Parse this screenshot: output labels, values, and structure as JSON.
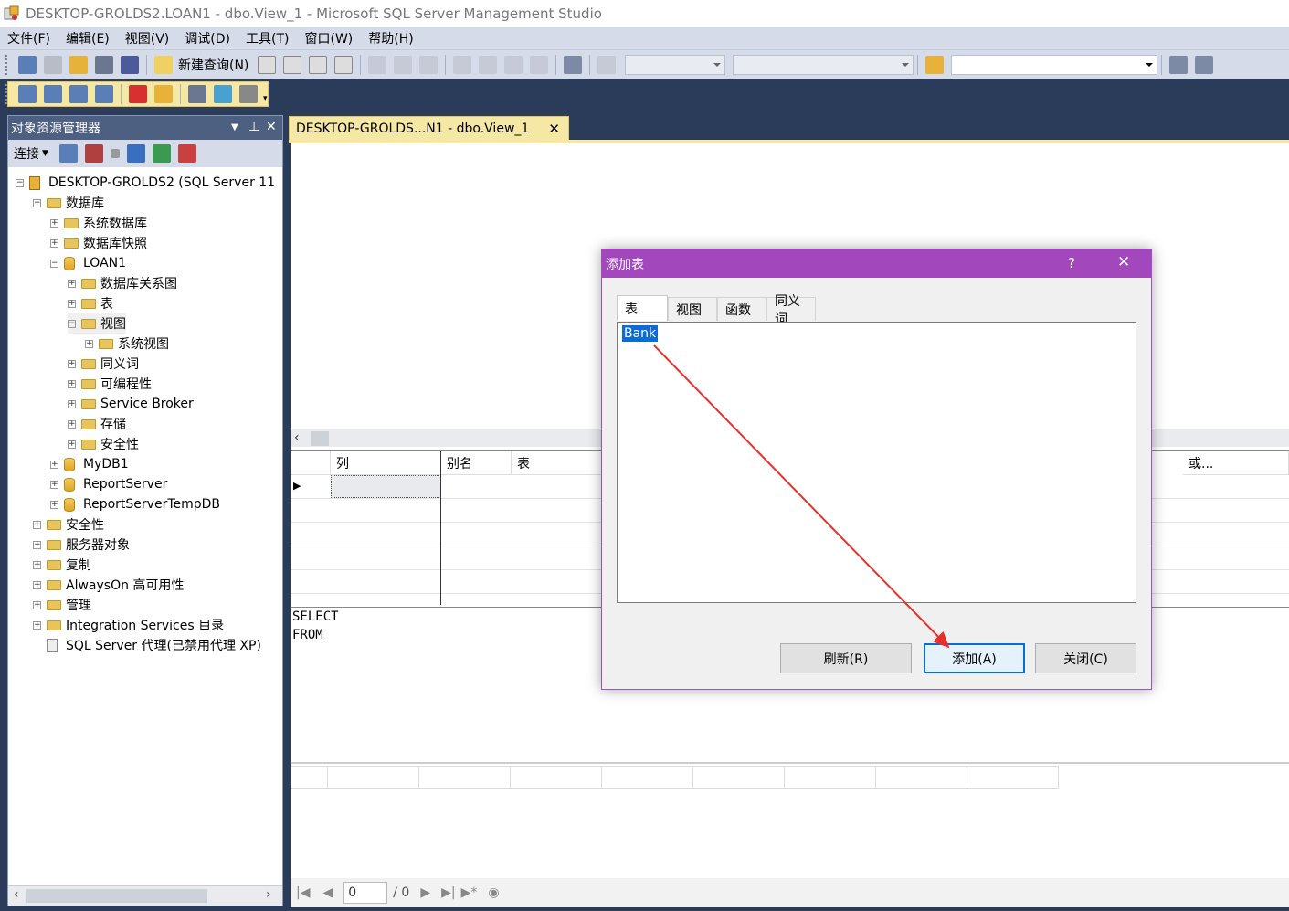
{
  "window": {
    "title": "DESKTOP-GROLDS2.LOAN1 - dbo.View_1 - Microsoft SQL Server Management Studio"
  },
  "menu": [
    "文件(F)",
    "编辑(E)",
    "视图(V)",
    "调试(D)",
    "工具(T)",
    "窗口(W)",
    "帮助(H)"
  ],
  "toolbar": {
    "new_query": "新建查询(N)"
  },
  "object_explorer": {
    "title": "对象资源管理器",
    "connect_label": "连接",
    "pin": "ᵠ",
    "close": "✕",
    "tree": [
      {
        "label": "DESKTOP-GROLDS2 (SQL Server 11",
        "level": 0,
        "icon": "server-icon",
        "exp": "−"
      },
      {
        "label": "数据库",
        "level": 1,
        "icon": "folder-icon",
        "exp": "−"
      },
      {
        "label": "系统数据库",
        "level": 2,
        "icon": "folder-icon",
        "exp": "+"
      },
      {
        "label": "数据库快照",
        "level": 2,
        "icon": "folder-icon",
        "exp": "+"
      },
      {
        "label": "LOAN1",
        "level": 2,
        "icon": "database-icon",
        "exp": "−"
      },
      {
        "label": "数据库关系图",
        "level": 3,
        "icon": "folder-icon",
        "exp": "+"
      },
      {
        "label": "表",
        "level": 3,
        "icon": "folder-icon",
        "exp": "+"
      },
      {
        "label": "视图",
        "level": 3,
        "icon": "folder-icon",
        "exp": "−"
      },
      {
        "label": "系统视图",
        "level": 4,
        "icon": "folder-icon",
        "exp": "+"
      },
      {
        "label": "同义词",
        "level": 3,
        "icon": "folder-icon",
        "exp": "+"
      },
      {
        "label": "可编程性",
        "level": 3,
        "icon": "folder-icon",
        "exp": "+"
      },
      {
        "label": "Service Broker",
        "level": 3,
        "icon": "folder-icon",
        "exp": "+"
      },
      {
        "label": "存储",
        "level": 3,
        "icon": "folder-icon",
        "exp": "+"
      },
      {
        "label": "安全性",
        "level": 3,
        "icon": "folder-icon",
        "exp": "+"
      },
      {
        "label": "MyDB1",
        "level": 2,
        "icon": "database-icon",
        "exp": "+"
      },
      {
        "label": "ReportServer",
        "level": 2,
        "icon": "database-icon",
        "exp": "+"
      },
      {
        "label": "ReportServerTempDB",
        "level": 2,
        "icon": "database-icon",
        "exp": "+"
      },
      {
        "label": "安全性",
        "level": 1,
        "icon": "folder-icon",
        "exp": "+"
      },
      {
        "label": "服务器对象",
        "level": 1,
        "icon": "folder-icon",
        "exp": "+"
      },
      {
        "label": "复制",
        "level": 1,
        "icon": "folder-icon",
        "exp": "+"
      },
      {
        "label": "AlwaysOn 高可用性",
        "level": 1,
        "icon": "folder-icon",
        "exp": "+"
      },
      {
        "label": "管理",
        "level": 1,
        "icon": "folder-icon",
        "exp": "+"
      },
      {
        "label": "Integration Services 目录",
        "level": 1,
        "icon": "folder-icon",
        "exp": "+"
      },
      {
        "label": "SQL Server 代理(已禁用代理 XP)",
        "level": 1,
        "icon": "agent-icon",
        "exp": ""
      }
    ]
  },
  "document": {
    "tab_title": "DESKTOP-GROLDS...N1 - dbo.View_1",
    "grid_headers": {
      "col": "列",
      "alias": "别名",
      "table": "表",
      "or": "或..."
    },
    "sql": [
      "SELECT",
      "FROM"
    ],
    "nav": {
      "page": "0",
      "total": "/ 0"
    }
  },
  "dialog": {
    "title": "添加表",
    "help": "?",
    "close": "✕",
    "tabs": [
      "表",
      "视图",
      "函数",
      "同义词"
    ],
    "items": [
      "Bank"
    ],
    "refresh": "刷新(R)",
    "add": "添加(A)",
    "close_btn": "关闭(C)"
  },
  "colors": {
    "dialog_title": "#a347bd",
    "selection": "#0a6cd6",
    "annotation_arrow": "#e8302a"
  }
}
